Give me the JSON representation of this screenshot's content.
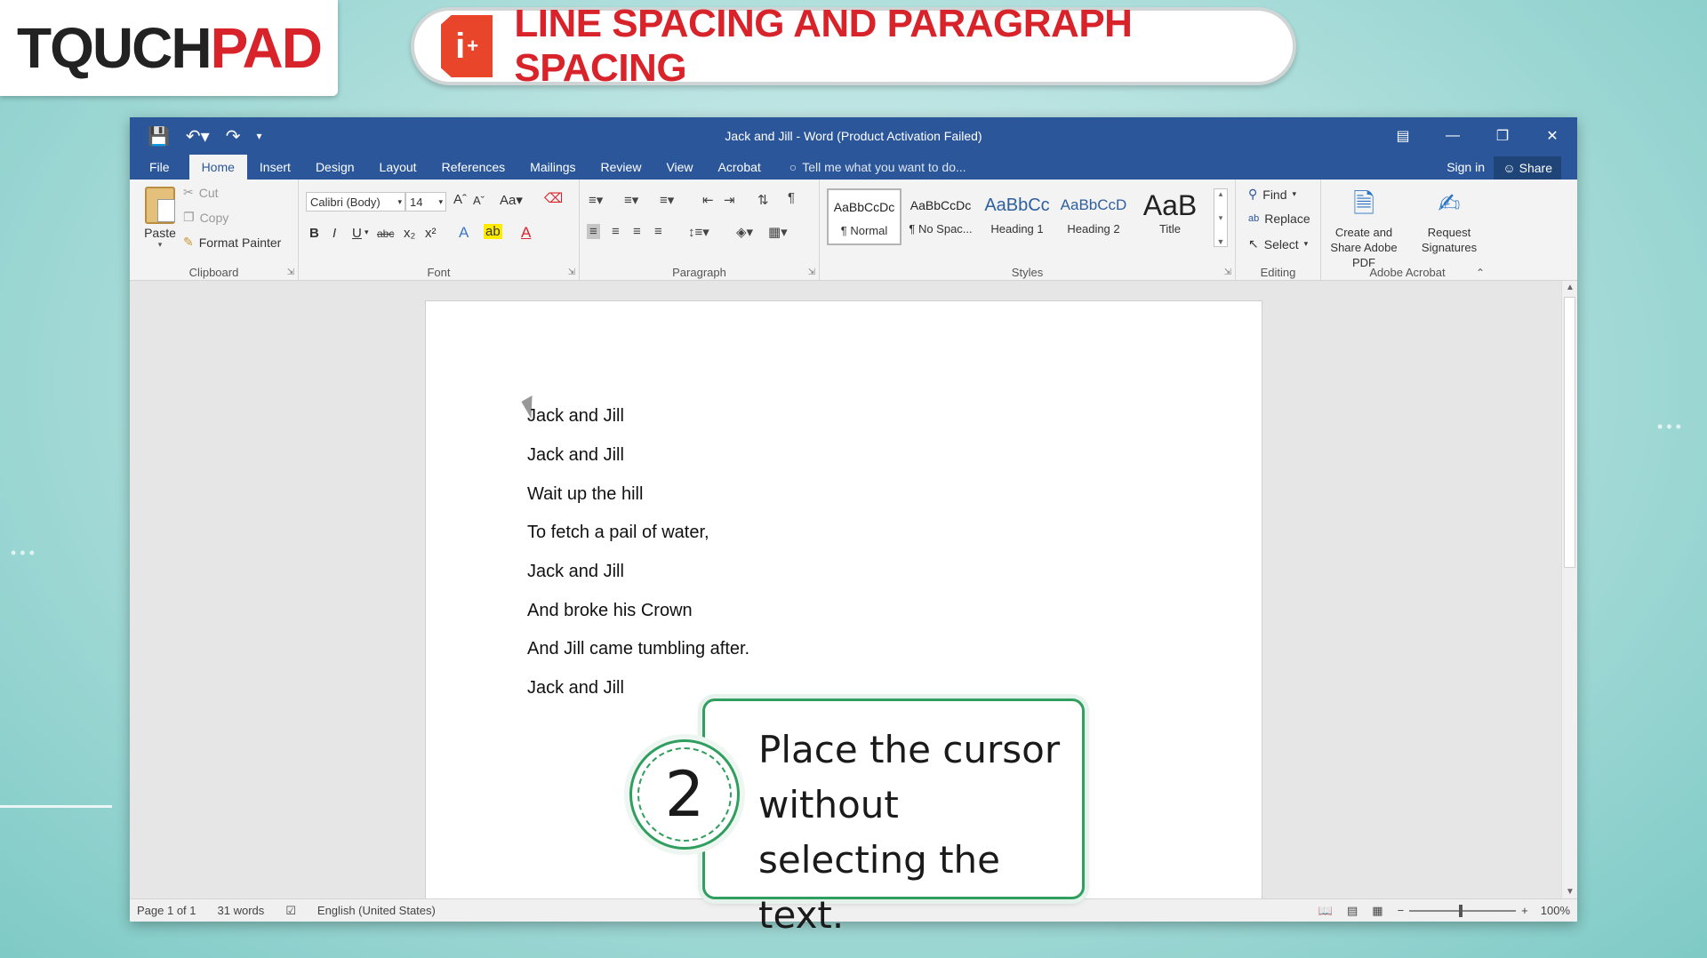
{
  "logo": {
    "part1": "TQUCH",
    "part2": "PAD"
  },
  "banner": {
    "title": "LINE SPACING AND PARAGRAPH SPACING",
    "icon_letter": "i"
  },
  "window": {
    "doc_title": "Jack and Jill - Word (Product Activation Failed)",
    "qat": [
      "save-icon",
      "undo-icon",
      "redo-icon",
      "customize-icon"
    ]
  },
  "tabs": [
    "File",
    "Home",
    "Insert",
    "Design",
    "Layout",
    "References",
    "Mailings",
    "Review",
    "View",
    "Acrobat"
  ],
  "active_tab": "Home",
  "tell_me": "Tell me what you want to do...",
  "sign_in": "Sign in",
  "share": "Share",
  "clipboard": {
    "paste": "Paste",
    "cut": "Cut",
    "copy": "Copy",
    "format_painter": "Format Painter",
    "label": "Clipboard"
  },
  "font": {
    "name": "Calibri (Body)",
    "size": "14",
    "label": "Font"
  },
  "paragraph": {
    "label": "Paragraph"
  },
  "styles": {
    "label": "Styles",
    "items": [
      {
        "preview": "AaBbCcDc",
        "name": "¶ Normal"
      },
      {
        "preview": "AaBbCcDc",
        "name": "¶ No Spac..."
      },
      {
        "preview": "AaBbCc",
        "name": "Heading 1"
      },
      {
        "preview": "AaBbCcD",
        "name": "Heading 2"
      },
      {
        "preview": "AaB",
        "name": "Title"
      }
    ]
  },
  "editing": {
    "find": "Find",
    "replace": "Replace",
    "select": "Select",
    "label": "Editing"
  },
  "acrobat": {
    "create": "Create and Share Adobe PDF",
    "request": "Request Signatures",
    "label": "Adobe Acrobat"
  },
  "document": {
    "paragraphs": [
      "Jack and Jill",
      "Jack and Jill",
      "Wait up the hill",
      "To fetch a pail of water,",
      "Jack and Jill",
      "And broke his Crown",
      "And Jill came tumbling after.",
      "Jack and Jill"
    ]
  },
  "status": {
    "page": "Page 1 of 1",
    "words": "31 words",
    "language": "English (United States)",
    "zoom": "100%"
  },
  "callout": {
    "step": "2",
    "text": "Place the cursor without selecting the text."
  }
}
